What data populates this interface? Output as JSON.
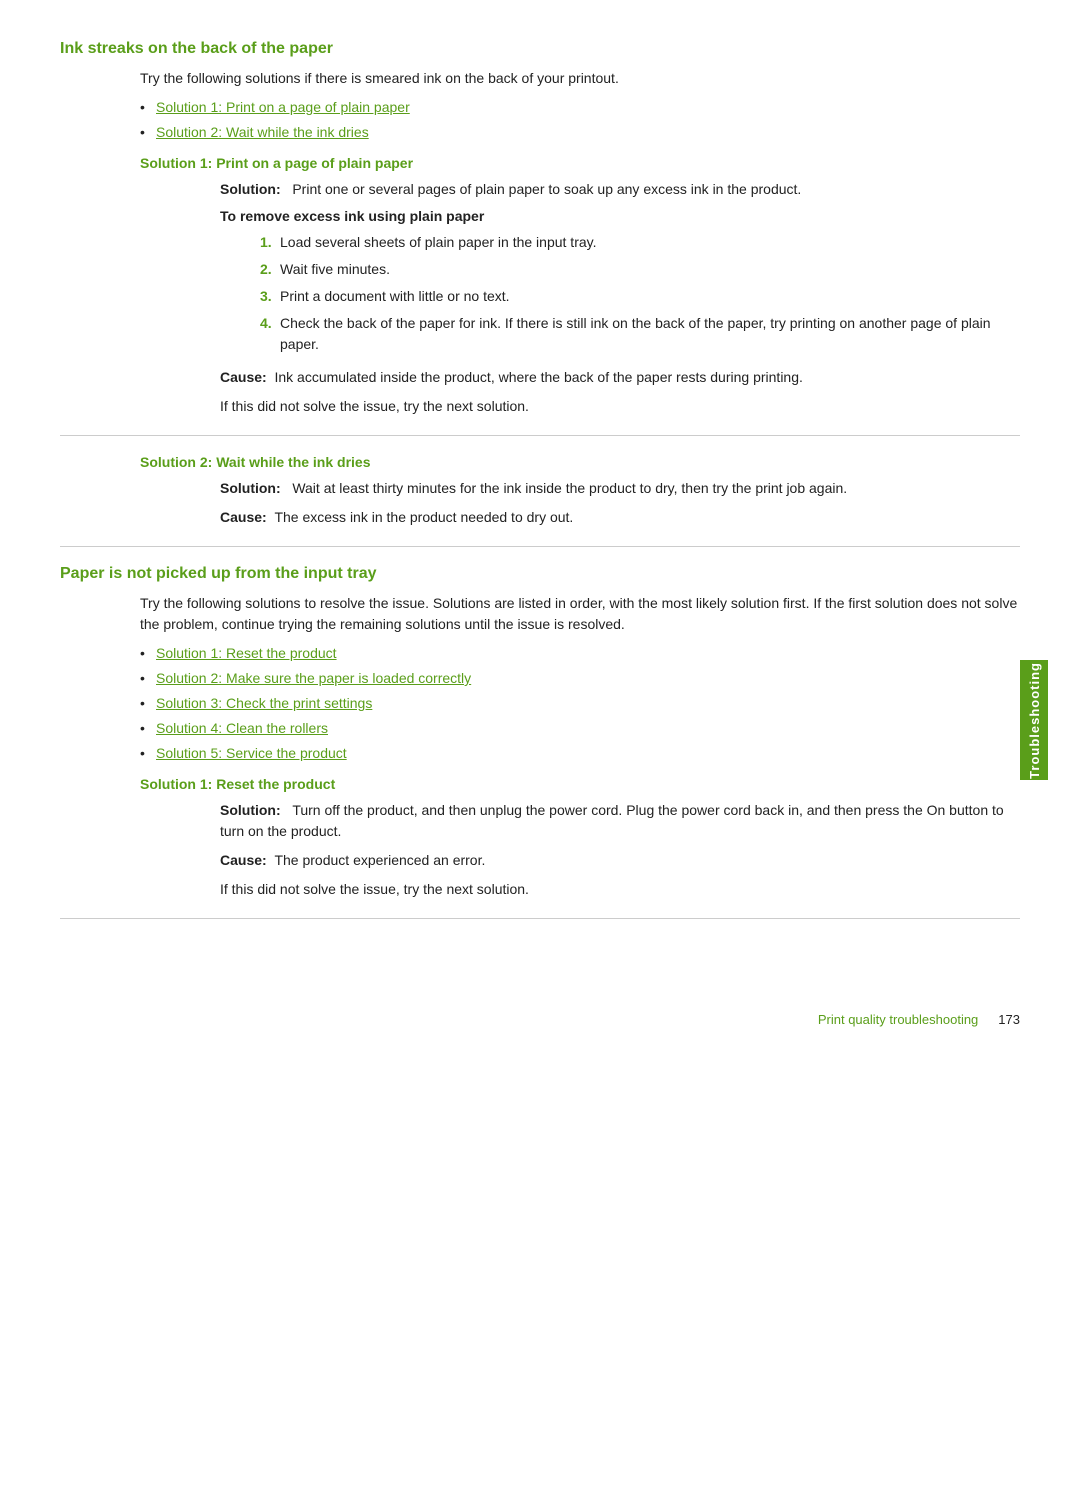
{
  "page": {
    "section1": {
      "heading": "Ink streaks on the back of the paper",
      "intro": "Try the following solutions if there is smeared ink on the back of your printout.",
      "links": [
        "Solution 1: Print on a page of plain paper",
        "Solution 2: Wait while the ink dries"
      ],
      "solution1": {
        "heading": "Solution 1: Print on a page of plain paper",
        "solution_label": "Solution:",
        "solution_text": "Print one or several pages of plain paper to soak up any excess ink in the product.",
        "subheading": "To remove excess ink using plain paper",
        "steps": [
          "Load several sheets of plain paper in the input tray.",
          "Wait five minutes.",
          "Print a document with little or no text.",
          "Check the back of the paper for ink. If there is still ink on the back of the paper, try printing on another page of plain paper."
        ],
        "cause_label": "Cause:",
        "cause_text": "Ink accumulated inside the product, where the back of the paper rests during printing.",
        "if_text": "If this did not solve the issue, try the next solution."
      },
      "solution2": {
        "heading": "Solution 2: Wait while the ink dries",
        "solution_label": "Solution:",
        "solution_text": "Wait at least thirty minutes for the ink inside the product to dry, then try the print job again.",
        "cause_label": "Cause:",
        "cause_text": "The excess ink in the product needed to dry out."
      }
    },
    "section2": {
      "heading": "Paper is not picked up from the input tray",
      "intro": "Try the following solutions to resolve the issue. Solutions are listed in order, with the most likely solution first. If the first solution does not solve the problem, continue trying the remaining solutions until the issue is resolved.",
      "links": [
        "Solution 1: Reset the product",
        "Solution 2: Make sure the paper is loaded correctly",
        "Solution 3: Check the print settings",
        "Solution 4: Clean the rollers",
        "Solution 5: Service the product"
      ],
      "solution1": {
        "heading": "Solution 1: Reset the product",
        "solution_label": "Solution:",
        "solution_text": "Turn off the product, and then unplug the power cord. Plug the power cord back in, and then press the On button to turn on the product.",
        "cause_label": "Cause:",
        "cause_text": "The product experienced an error.",
        "if_text": "If this did not solve the issue, try the next solution."
      }
    },
    "side_tab": "Troubleshooting",
    "footer": {
      "link_text": "Print quality troubleshooting",
      "page_number": "173"
    }
  }
}
